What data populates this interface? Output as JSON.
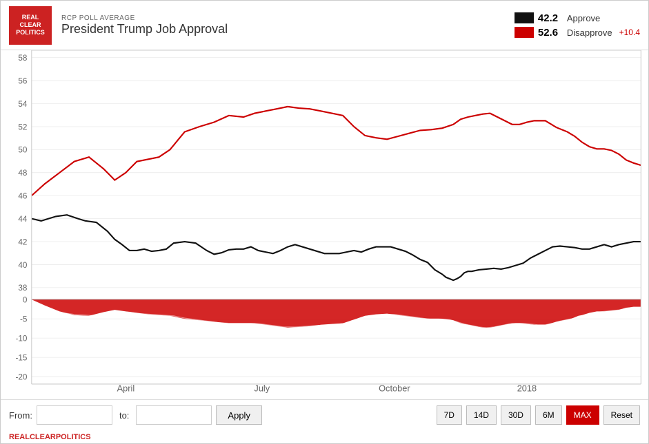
{
  "header": {
    "rcp_label": "RCP POLL AVERAGE",
    "chart_title": "President Trump Job Approval",
    "logo_lines": [
      "REAL",
      "CLEAR",
      "POLITICS"
    ]
  },
  "legend": {
    "approve_value": "42.2",
    "approve_label": "Approve",
    "disapprove_value": "52.6",
    "disapprove_label": "Disapprove",
    "disapprove_diff": "+10.4"
  },
  "chart": {
    "y_axis_labels": [
      "58",
      "56",
      "54",
      "52",
      "50",
      "48",
      "46",
      "44",
      "42",
      "40",
      "38"
    ],
    "y_axis_bottom_labels": [
      "0",
      "-5",
      "-10",
      "-15",
      "-20"
    ],
    "x_axis_labels": [
      "April",
      "July",
      "October",
      "2018"
    ]
  },
  "footer": {
    "from_label": "From:",
    "to_label": "to:",
    "from_value": "",
    "to_value": "",
    "apply_label": "Apply",
    "buttons": [
      "7D",
      "14D",
      "30D",
      "6M",
      "MAX",
      "Reset"
    ],
    "active_button": "MAX"
  },
  "branding": {
    "footer_text": "REALCLEARPOLITICS"
  }
}
